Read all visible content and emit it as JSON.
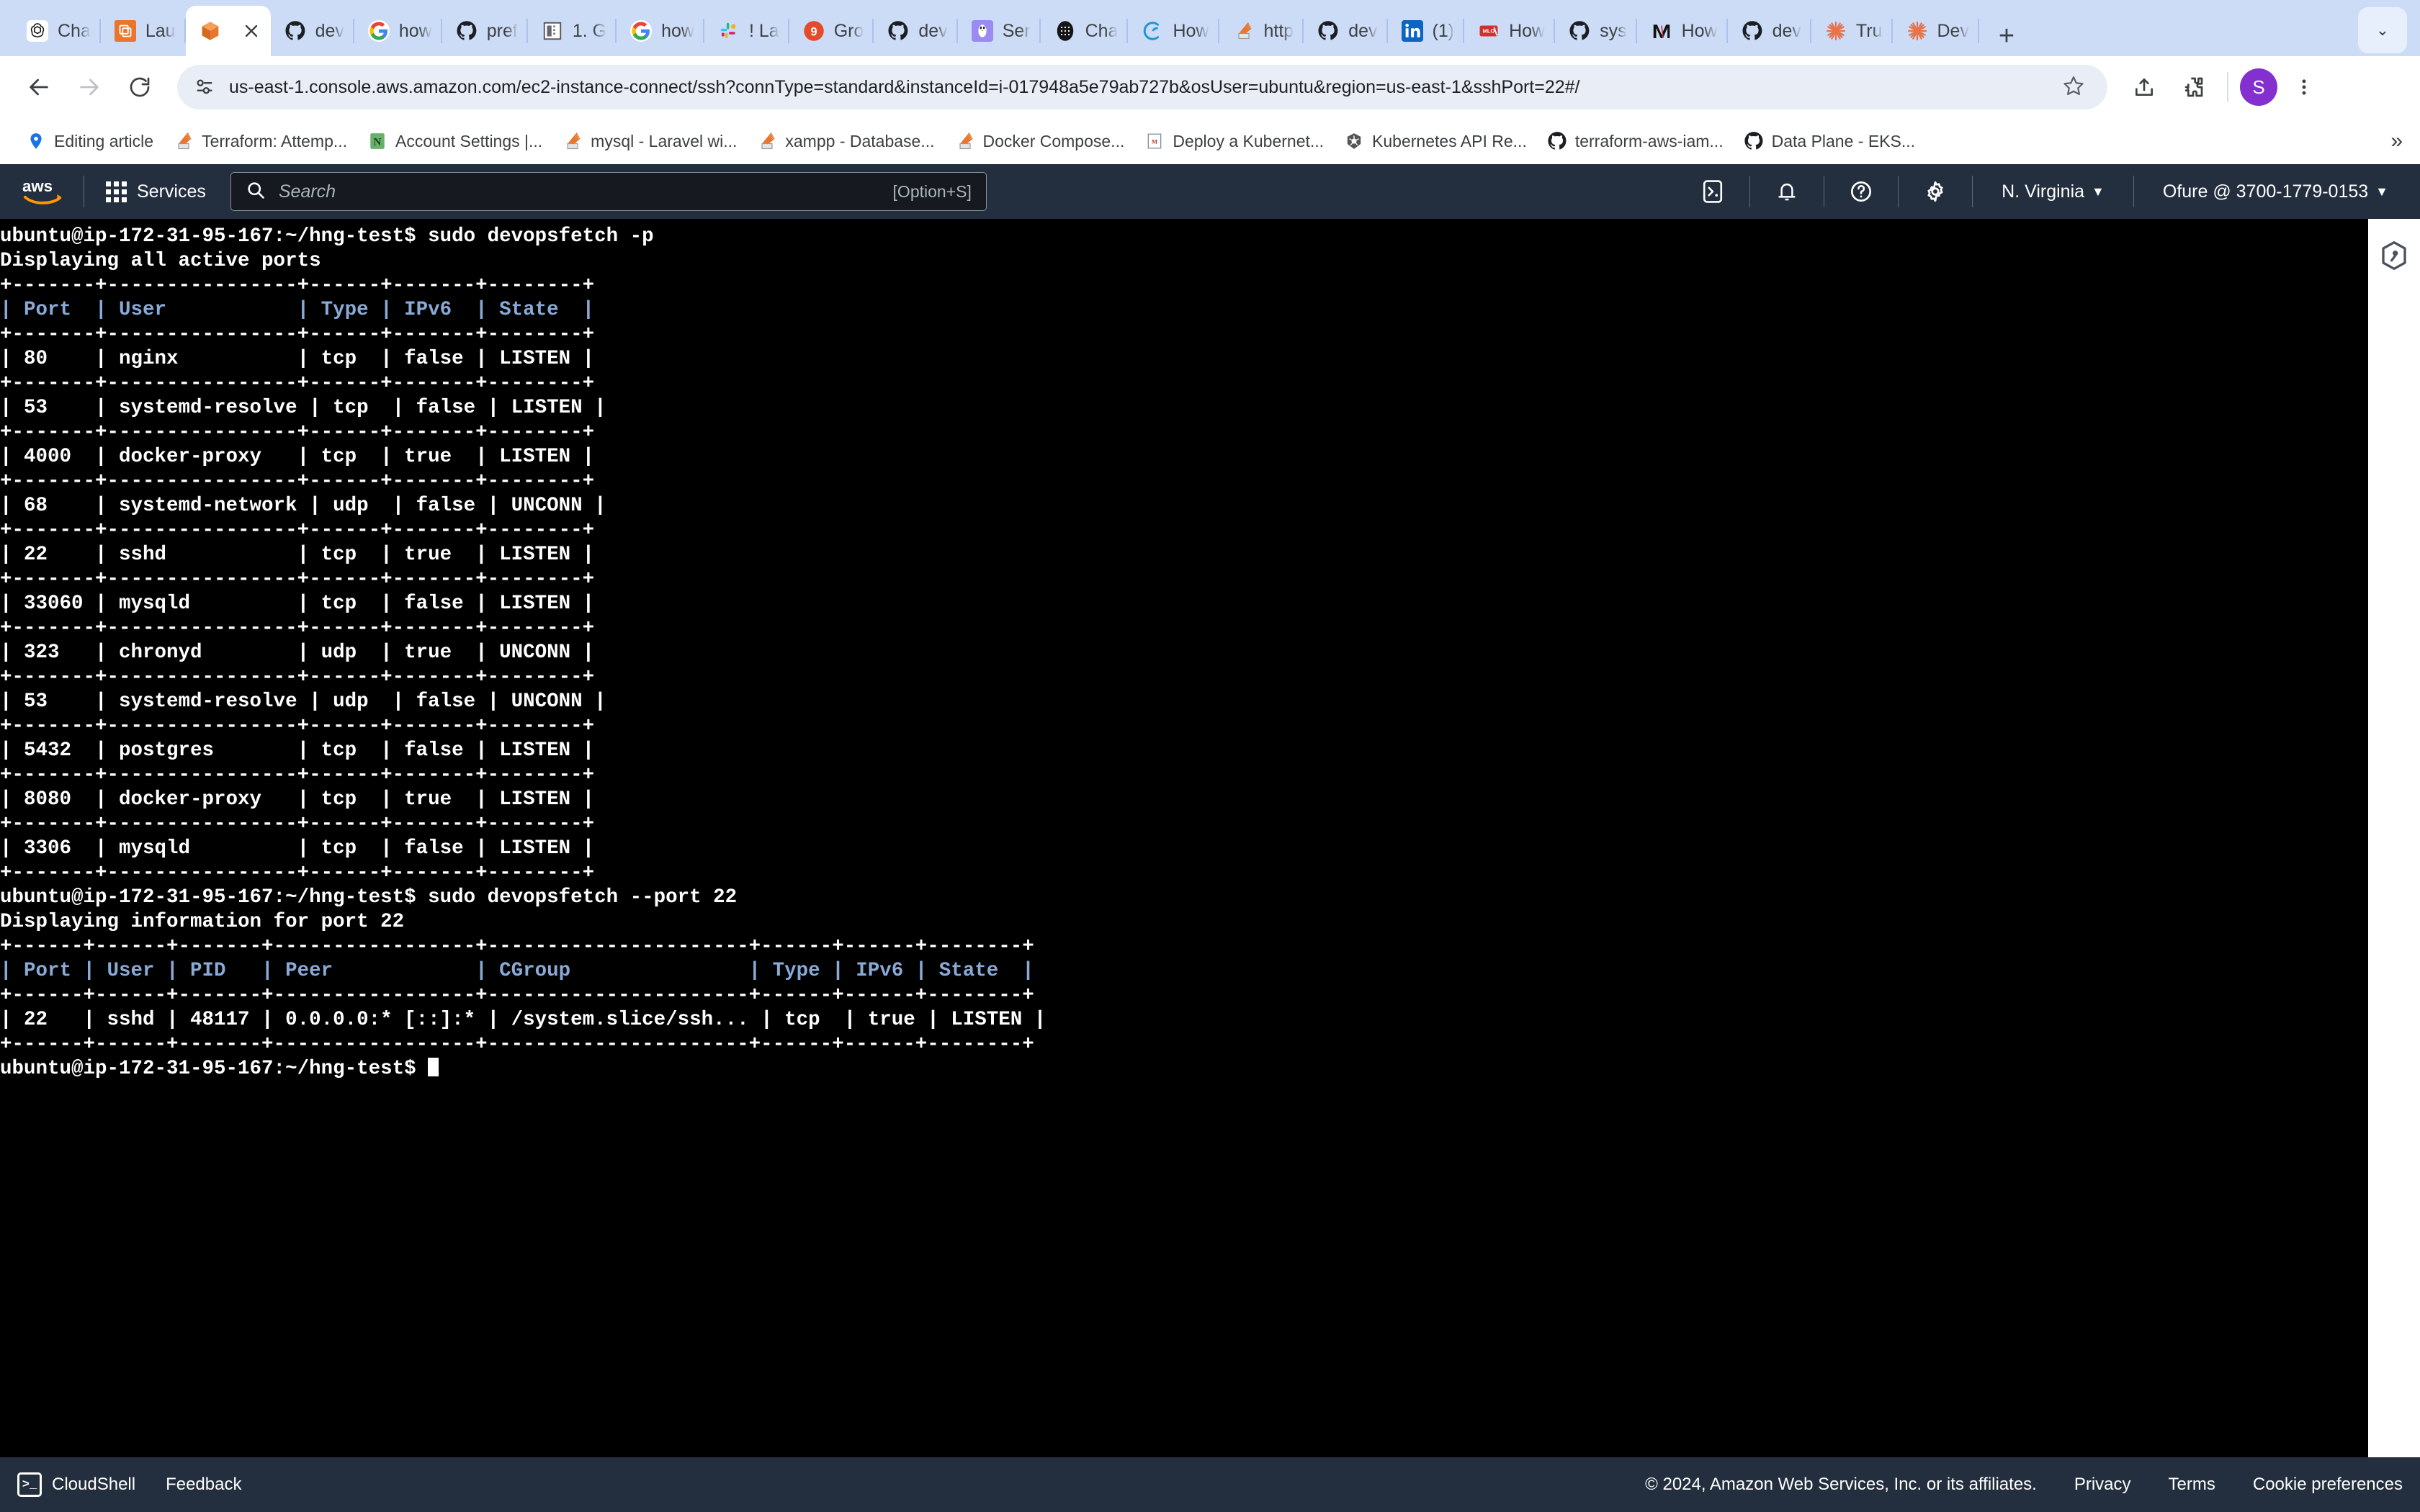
{
  "browser": {
    "tabs": [
      {
        "title": "Cha",
        "icon": "openai-icon"
      },
      {
        "title": "Lau",
        "icon": "aws-ec2-icon"
      },
      {
        "title": "",
        "icon": "aws-cube-icon",
        "active": true
      },
      {
        "title": "dev",
        "icon": "github-icon"
      },
      {
        "title": "how",
        "icon": "google-icon"
      },
      {
        "title": "pref",
        "icon": "github-icon"
      },
      {
        "title": "1. G",
        "icon": "building-icon"
      },
      {
        "title": "how",
        "icon": "google-icon"
      },
      {
        "title": "! La",
        "icon": "slack-icon"
      },
      {
        "title": "Gro",
        "icon": "grafana-icon"
      },
      {
        "title": "dev",
        "icon": "github-icon"
      },
      {
        "title": "Ser",
        "icon": "linux-icon"
      },
      {
        "title": "Cha",
        "icon": "dots-circle-icon"
      },
      {
        "title": "How",
        "icon": "swirl-icon"
      },
      {
        "title": "http",
        "icon": "apache-icon"
      },
      {
        "title": "dev",
        "icon": "github-icon"
      },
      {
        "title": "(1) ",
        "icon": "linkedin-icon"
      },
      {
        "title": "How",
        "icon": "mlo-icon"
      },
      {
        "title": "sys",
        "icon": "github-icon"
      },
      {
        "title": "How",
        "icon": "medium-m-icon"
      },
      {
        "title": "dev",
        "icon": "github-icon"
      },
      {
        "title": "Tru",
        "icon": "asterisk-icon"
      },
      {
        "title": "Dev",
        "icon": "asterisk-icon"
      }
    ],
    "new_tab_label": "+",
    "tab_list_chevron": "⌄",
    "address": {
      "url": "us-east-1.console.aws.amazon.com/ec2-instance-connect/ssh?connType=standard&instanceId=i-017948a5e79ab727b&osUser=ubuntu&region=us-east-1&sshPort=22#/",
      "site_info_icon": "page-info-icon",
      "bookmark_icon": "star-icon"
    },
    "nav": {
      "back": "←",
      "forward": "→",
      "reload": "↻"
    },
    "toolbar_icons": [
      "share-icon",
      "extensions-puzzle-icon",
      "profile-avatar",
      "chrome-menu-icon"
    ],
    "profile_initial": "S",
    "bookmarks": [
      {
        "label": "Editing article",
        "icon": "location-pin-icon"
      },
      {
        "label": "Terraform: Attemp...",
        "icon": "apache-icon"
      },
      {
        "label": "Account Settings |...",
        "icon": "notion-n-icon"
      },
      {
        "label": "mysql - Laravel wi...",
        "icon": "apache-icon"
      },
      {
        "label": "xampp - Database...",
        "icon": "apache-icon"
      },
      {
        "label": "Docker Compose...",
        "icon": "apache-icon"
      },
      {
        "label": "Deploy a Kubernet...",
        "icon": "medium-icon"
      },
      {
        "label": "Kubernetes API Re...",
        "icon": "kubernetes-icon"
      },
      {
        "label": "terraform-aws-iam...",
        "icon": "github-icon"
      },
      {
        "label": "Data Plane - EKS...",
        "icon": "github-icon"
      }
    ],
    "bookmarks_overflow": "»"
  },
  "aws": {
    "logo": "aws-logo",
    "services_label": "Services",
    "search": {
      "placeholder": "Search",
      "shortcut": "[Option+S]",
      "icon": "search-icon"
    },
    "icons": [
      "cloudshell-icon",
      "notifications-bell-icon",
      "help-question-icon",
      "settings-gear-icon"
    ],
    "region": "N. Virginia",
    "region_caret": "▼",
    "account": "Ofure @ 3700-1779-0153",
    "account_caret": "▼"
  },
  "rail": {
    "icon": "hexagon-shield-icon"
  },
  "terminal": {
    "prompt1": "ubuntu@ip-172-31-95-167:~/hng-test$ sudo devopsfetch -p",
    "status1": "Displaying all active ports",
    "table1": {
      "rule": "+-------+----------------+------+-------+--------+",
      "header": "| Port  | User           | Type | IPv6  | State  |",
      "rows": [
        "| 80    | nginx          | tcp  | false | LISTEN |",
        "| 53    | systemd-resolve | tcp  | false | LISTEN |",
        "| 4000  | docker-proxy   | tcp  | true  | LISTEN |",
        "| 68    | systemd-network | udp  | false | UNCONN |",
        "| 22    | sshd           | tcp  | true  | LISTEN |",
        "| 33060 | mysqld         | tcp  | false | LISTEN |",
        "| 323   | chronyd        | udp  | true  | UNCONN |",
        "| 53    | systemd-resolve | udp  | false | UNCONN |",
        "| 5432  | postgres       | tcp  | false | LISTEN |",
        "| 8080  | docker-proxy   | tcp  | true  | LISTEN |",
        "| 3306  | mysqld         | tcp  | false | LISTEN |"
      ]
    },
    "prompt2": "ubuntu@ip-172-31-95-167:~/hng-test$ sudo devopsfetch --port 22",
    "status2": "Displaying information for port 22",
    "table2": {
      "rule": "+------+------+-------+-----------------+----------------------+------+------+--------+",
      "header": "| Port | User | PID   | Peer            | CGroup               | Type | IPv6 | State  |",
      "row": "| 22   | sshd | 48117 | 0.0.0.0:* [::]:* | /system.slice/ssh... | tcp  | true | LISTEN |"
    },
    "prompt3": "ubuntu@ip-172-31-95-167:~/hng-test$ ",
    "colors": {
      "background": "#000000",
      "text": "#ffffff",
      "header_text": "#89a9d6"
    }
  },
  "footer": {
    "cloudshell": "CloudShell",
    "feedback": "Feedback",
    "copyright": "© 2024, Amazon Web Services, Inc. or its affiliates.",
    "privacy": "Privacy",
    "terms": "Terms",
    "cookie_preferences": "Cookie preferences"
  }
}
